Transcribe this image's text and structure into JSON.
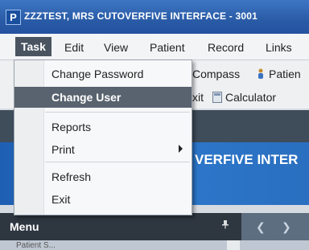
{
  "window": {
    "app_icon_letter": "P",
    "title": "ZZZTEST, MRS CUTOVERFIVE INTERFACE - 3001"
  },
  "menubar": {
    "items": [
      "Task",
      "Edit",
      "View",
      "Patient",
      "Record",
      "Links"
    ]
  },
  "toolbar": {
    "compass_label": "Compass",
    "patient_label": "Patien",
    "exit_label": "xit",
    "calculator_label": "Calculator"
  },
  "banner": {
    "text": "VERFIVE INTER"
  },
  "menu_panel": {
    "label": "Menu",
    "pin_icon": "pin-icon"
  },
  "bottom": {
    "label": "Patient S..."
  },
  "dropdown": {
    "items": [
      "Change Password",
      "Change User",
      "Reports",
      "Print",
      "Refresh",
      "Exit"
    ],
    "highlighted": "Change User",
    "submenu_item": "Print"
  },
  "colors": {
    "titlebar": "#2a5ba6",
    "menu_active": "#4a5461",
    "highlight": "#59636f",
    "banner": "#2c76c9"
  }
}
